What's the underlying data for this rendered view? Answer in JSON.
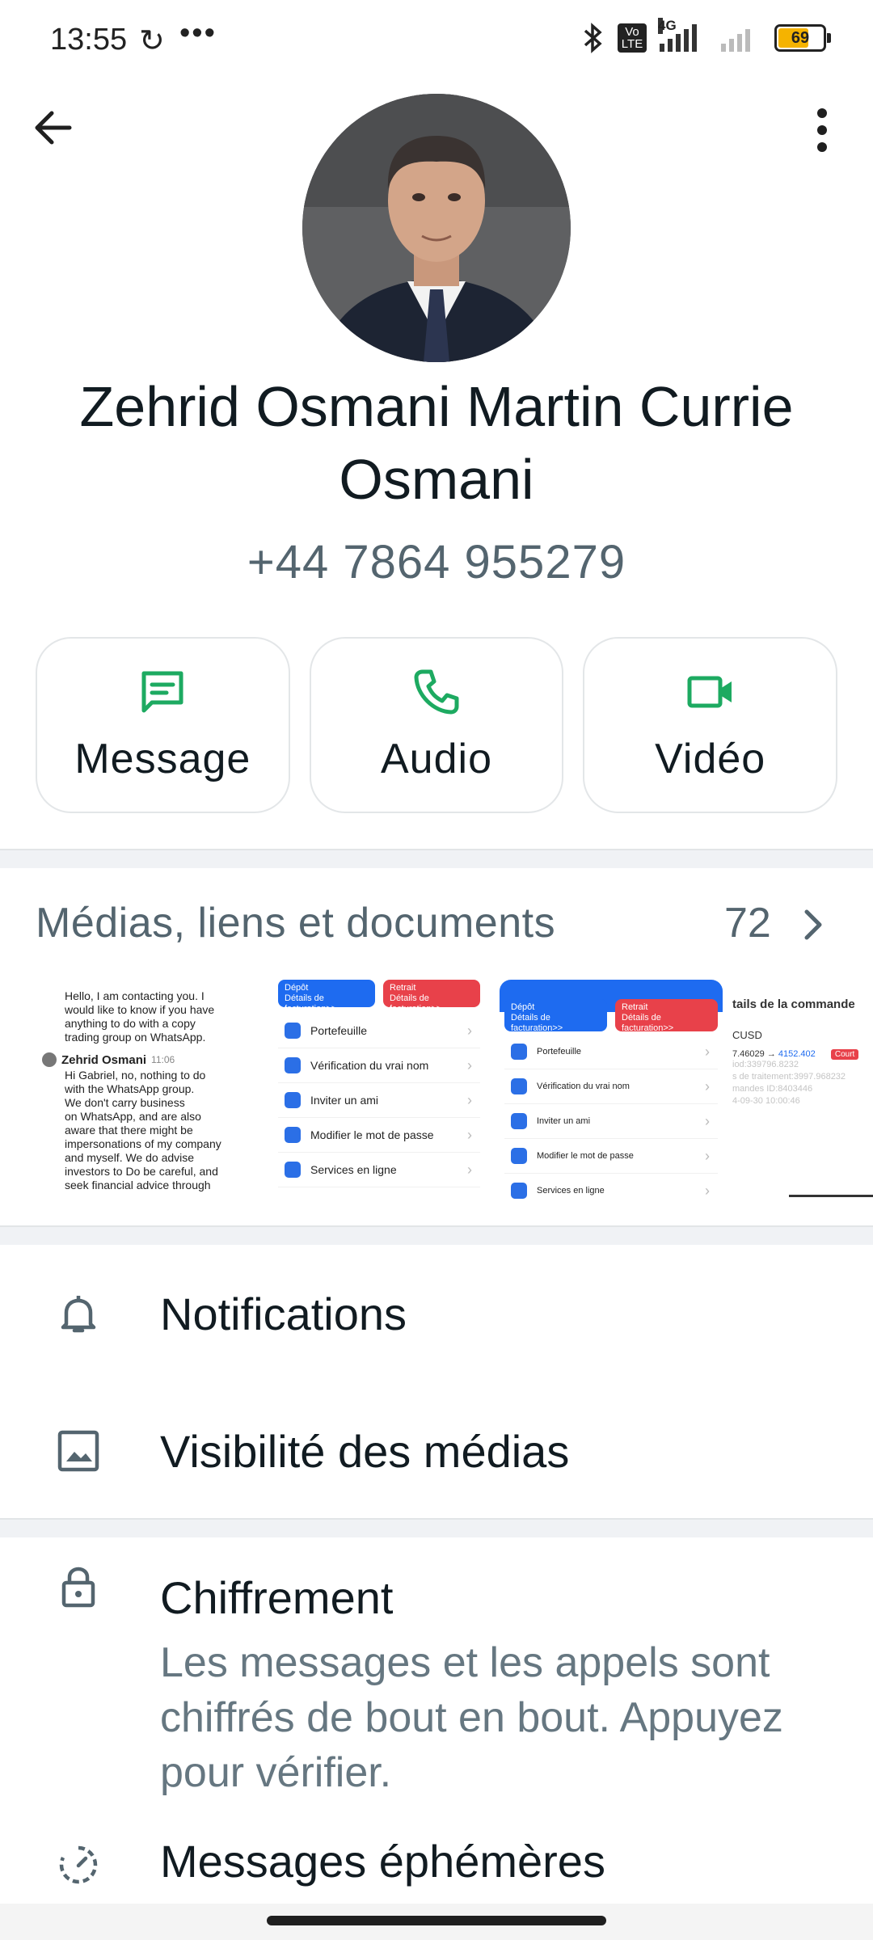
{
  "status_bar": {
    "time": "13:55",
    "sync_icon": "↻",
    "overflow": "•••",
    "volte": "Vo LTE",
    "network": "4G",
    "battery": "69",
    "battery_fraction": 0.69
  },
  "contact": {
    "name": "Zehrid Osmani Martin Currie Osmani",
    "phone": "+44 7864 955279"
  },
  "actions": [
    {
      "label": "Message",
      "icon": "message-icon"
    },
    {
      "label": "Audio",
      "icon": "phone-icon"
    },
    {
      "label": "Vidéo",
      "icon": "video-icon"
    }
  ],
  "media": {
    "title": "Médias, liens et documents",
    "count": "72",
    "chat_preview": {
      "msg1_lines": [
        "Hello, I am contacting you. I",
        "would like to know if you have",
        "anything to do with a copy",
        "trading group on WhatsApp."
      ],
      "sender": "Zehrid Osmani",
      "sender_time": "11:06",
      "msg2_lines": [
        "Hi Gabriel, no, nothing to do",
        "with the WhatsApp group.",
        "We don't carry business",
        "on WhatsApp, and are also",
        "aware that there might be",
        "impersonations of my company",
        "and myself. We do advise",
        "investors to Do be careful, and",
        "seek financial advice through"
      ]
    },
    "app_preview": {
      "deposit": "Dépôt",
      "withdraw": "Retrait",
      "invoice": "Détails de facturation>>",
      "menu": [
        "Portefeuille",
        "Vérification du vrai nom",
        "Inviter un ami",
        "Modifier le mot de passe",
        "Services en ligne"
      ]
    },
    "order_preview": {
      "title": "tails de la commande",
      "currency": "CUSD",
      "rate_from": "7.46029",
      "arrow": "→",
      "rate_to": "4152.402",
      "tag": "Court",
      "lines": [
        "iod:339796.8232",
        "s de traitement:3997.968232",
        "mandes ID:8403446",
        "4-09-30 10:00:46"
      ]
    }
  },
  "settings": {
    "notifications": "Notifications",
    "media_visibility": "Visibilité des médias",
    "encryption": "Chiffrement",
    "encryption_desc": "Les messages et les appels sont chiffrés de bout en bout. Appuyez pour vérifier.",
    "ephemeral": "Messages éphémères"
  },
  "colors": {
    "accent_green": "#1daa61",
    "secondary_text": "#54656f"
  }
}
